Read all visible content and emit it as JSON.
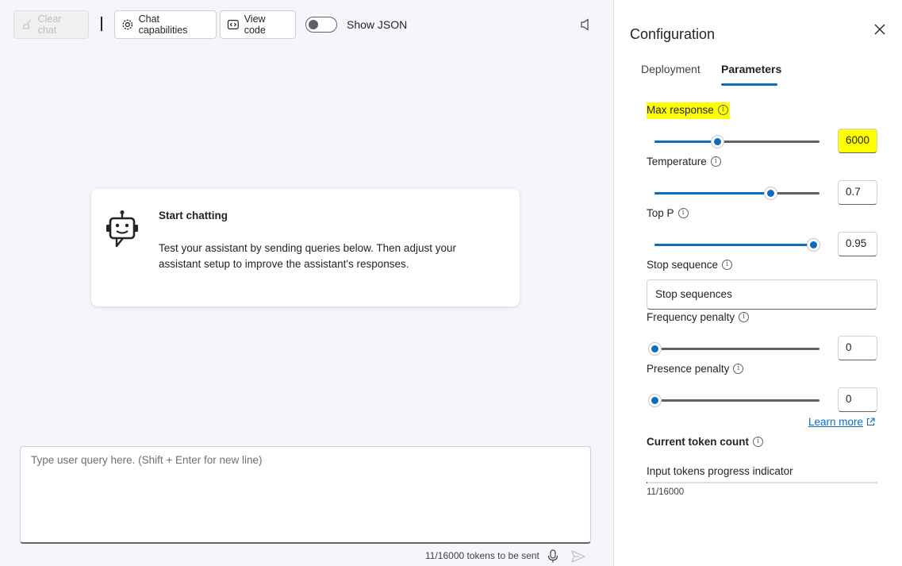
{
  "toolbar": {
    "clear_chat": "Clear chat",
    "chat_capabilities": "Chat capabilities",
    "view_code": "View code",
    "show_json": "Show JSON",
    "show_json_on": false
  },
  "card": {
    "title": "Start chatting",
    "description": "Test your assistant by sending queries below. Then adjust your assistant setup to improve the assistant's responses."
  },
  "chat_input": {
    "placeholder": "Type user query here. (Shift + Enter for new line)",
    "token_status": "11/16000 tokens to be sent"
  },
  "config": {
    "title": "Configuration",
    "tabs": [
      "Deployment",
      "Parameters"
    ],
    "active_tab": "Parameters",
    "params": {
      "max_response": {
        "label": "Max response",
        "value": "6000",
        "fraction": 0.38
      },
      "temperature": {
        "label": "Temperature",
        "value": "0.7",
        "fraction": 0.7
      },
      "top_p": {
        "label": "Top P",
        "value": "0.95",
        "fraction": 0.96
      },
      "stop_sequence": {
        "label": "Stop sequence",
        "placeholder": "Stop sequences"
      },
      "frequency_penalty": {
        "label": "Frequency penalty",
        "value": "0",
        "fraction": 0.0
      },
      "presence_penalty": {
        "label": "Presence penalty",
        "value": "0",
        "fraction": 0.0
      }
    },
    "learn_more": "Learn more",
    "token_count": {
      "title": "Current token count",
      "progress_label": "Input tokens progress indicator",
      "value": "11/16000",
      "fraction": 0.0007
    }
  },
  "colors": {
    "accent": "#0f6cbd",
    "highlight": "#ffff00"
  }
}
